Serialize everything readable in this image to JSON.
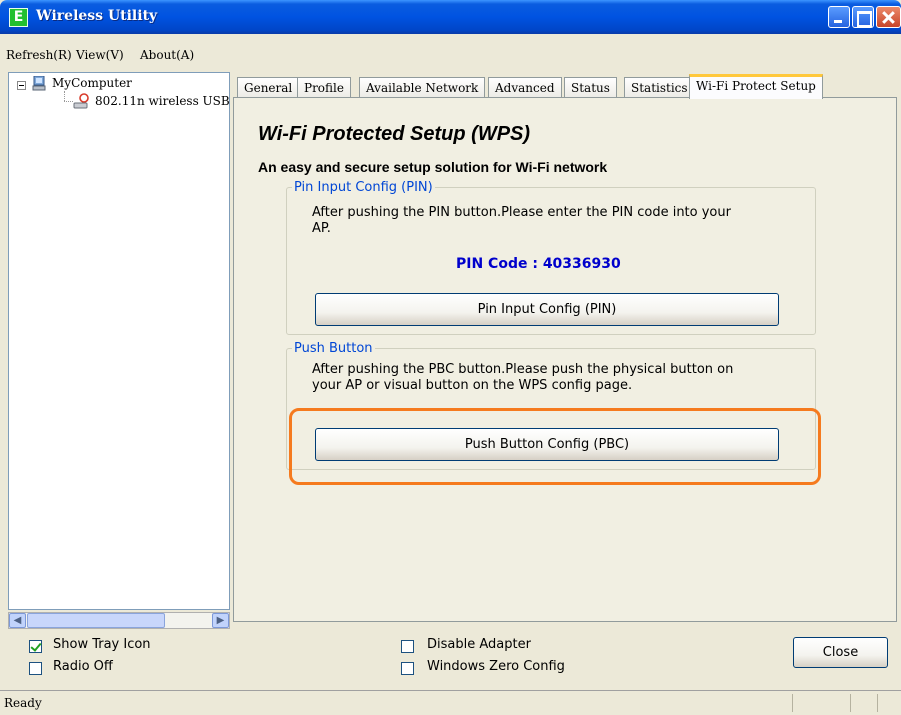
{
  "window": {
    "title": "Wireless Utility",
    "icon_letter": "E"
  },
  "menu": {
    "items": [
      "Refresh(R)",
      "View(V)",
      "About(A)"
    ]
  },
  "tree": {
    "root": "MyComputer",
    "child": "802.11n wireless USB"
  },
  "tabs": [
    "General",
    "Profile",
    "Available Network",
    "Advanced",
    "Status",
    "Statistics",
    "Wi-Fi Protect Setup"
  ],
  "active_tab": "Wi-Fi Protect Setup",
  "wps": {
    "title": "Wi-Fi Protected Setup (WPS)",
    "subtitle": "An easy and secure setup solution for Wi-Fi network",
    "pin_group": {
      "legend": "Pin Input Config (PIN)",
      "desc_line1": "After pushing the PIN button.Please enter the PIN code into your",
      "desc_line2": "AP.",
      "pin_code": "PIN Code :  40336930",
      "button": "Pin Input Config (PIN)"
    },
    "pbc_group": {
      "legend": "Push Button",
      "desc_line1": "After pushing the PBC button.Please push the physical button on",
      "desc_line2": "your AP or visual button on the WPS config page.",
      "button": "Push Button Config (PBC)"
    }
  },
  "bottom": {
    "show_tray_icon": {
      "label": "Show Tray Icon",
      "checked": true
    },
    "radio_off": {
      "label": "Radio Off",
      "checked": false
    },
    "disable_adapter": {
      "label": "Disable Adapter",
      "checked": false
    },
    "windows_zero_config": {
      "label": "Windows Zero Config",
      "checked": false
    },
    "close_button": "Close"
  },
  "status": {
    "text": "Ready"
  },
  "colors": {
    "titlebar": "#0053e1",
    "legend_text": "#0046d5",
    "pin_code": "#0000cc",
    "highlight": "#f57a1e"
  }
}
